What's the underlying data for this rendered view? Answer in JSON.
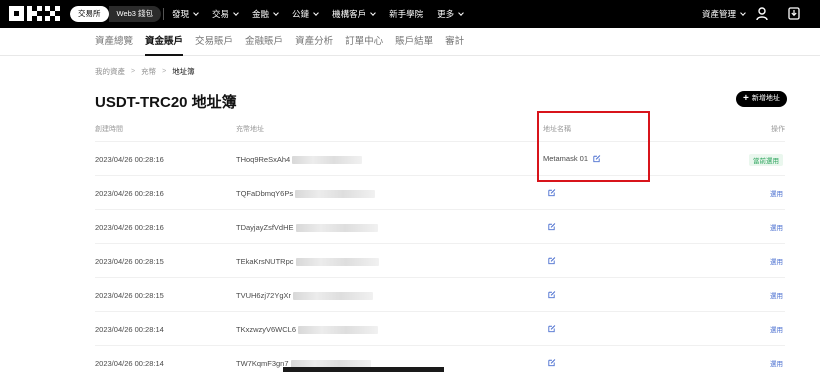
{
  "topbar": {
    "mode_tabs": [
      {
        "label": "交易所",
        "active": true
      },
      {
        "label": "Web3 錢包",
        "active": false
      }
    ],
    "nav": [
      {
        "label": "發現",
        "has_dropdown": true
      },
      {
        "label": "交易",
        "has_dropdown": true
      },
      {
        "label": "金融",
        "has_dropdown": true
      },
      {
        "label": "公鏈",
        "has_dropdown": true
      },
      {
        "label": "機構客戶",
        "has_dropdown": true
      },
      {
        "label": "新手學院",
        "has_dropdown": false
      },
      {
        "label": "更多",
        "has_dropdown": true
      }
    ],
    "asset_mgmt": "資產管理"
  },
  "subnav": [
    {
      "label": "資產總覽",
      "active": false
    },
    {
      "label": "資金賬戶",
      "active": true
    },
    {
      "label": "交易賬戶",
      "active": false
    },
    {
      "label": "金融賬戶",
      "active": false
    },
    {
      "label": "資產分析",
      "active": false
    },
    {
      "label": "訂單中心",
      "active": false
    },
    {
      "label": "賬戶結單",
      "active": false
    },
    {
      "label": "審計",
      "active": false
    }
  ],
  "breadcrumb": [
    "我的資產",
    "充幣",
    "地址簿"
  ],
  "page_title": "USDT-TRC20 地址簿",
  "add_button": "新增地址",
  "columns": {
    "time": "創建時間",
    "address": "充幣地址",
    "name": "地址名稱",
    "action": "操作"
  },
  "rows": [
    {
      "time": "2023/04/26 00:28:16",
      "address": "THoq9ReSxAh4",
      "name": "Metamask 01",
      "action": "當前選用",
      "is_default": true
    },
    {
      "time": "2023/04/26 00:28:16",
      "address": "TQFaDbmqY6Ps",
      "name": "",
      "action": "選用",
      "is_default": false
    },
    {
      "time": "2023/04/26 00:28:16",
      "address": "TDayjayZsfVdHE",
      "name": "",
      "action": "選用",
      "is_default": false
    },
    {
      "time": "2023/04/26 00:28:15",
      "address": "TEkaKrsNUTRpc",
      "name": "",
      "action": "選用",
      "is_default": false
    },
    {
      "time": "2023/04/26 00:28:15",
      "address": "TVUH6zj72YgXr",
      "name": "",
      "action": "選用",
      "is_default": false
    },
    {
      "time": "2023/04/26 00:28:14",
      "address": "TKxzwzyV6WCL6",
      "name": "",
      "action": "選用",
      "is_default": false
    },
    {
      "time": "2023/04/26 00:28:14",
      "address": "TW7KqmF3gn7",
      "name": "",
      "action": "選用",
      "is_default": false
    }
  ],
  "colors": {
    "highlight": "#d8141b",
    "default_badge_text": "#29a35a",
    "link": "#4a6fd0"
  }
}
